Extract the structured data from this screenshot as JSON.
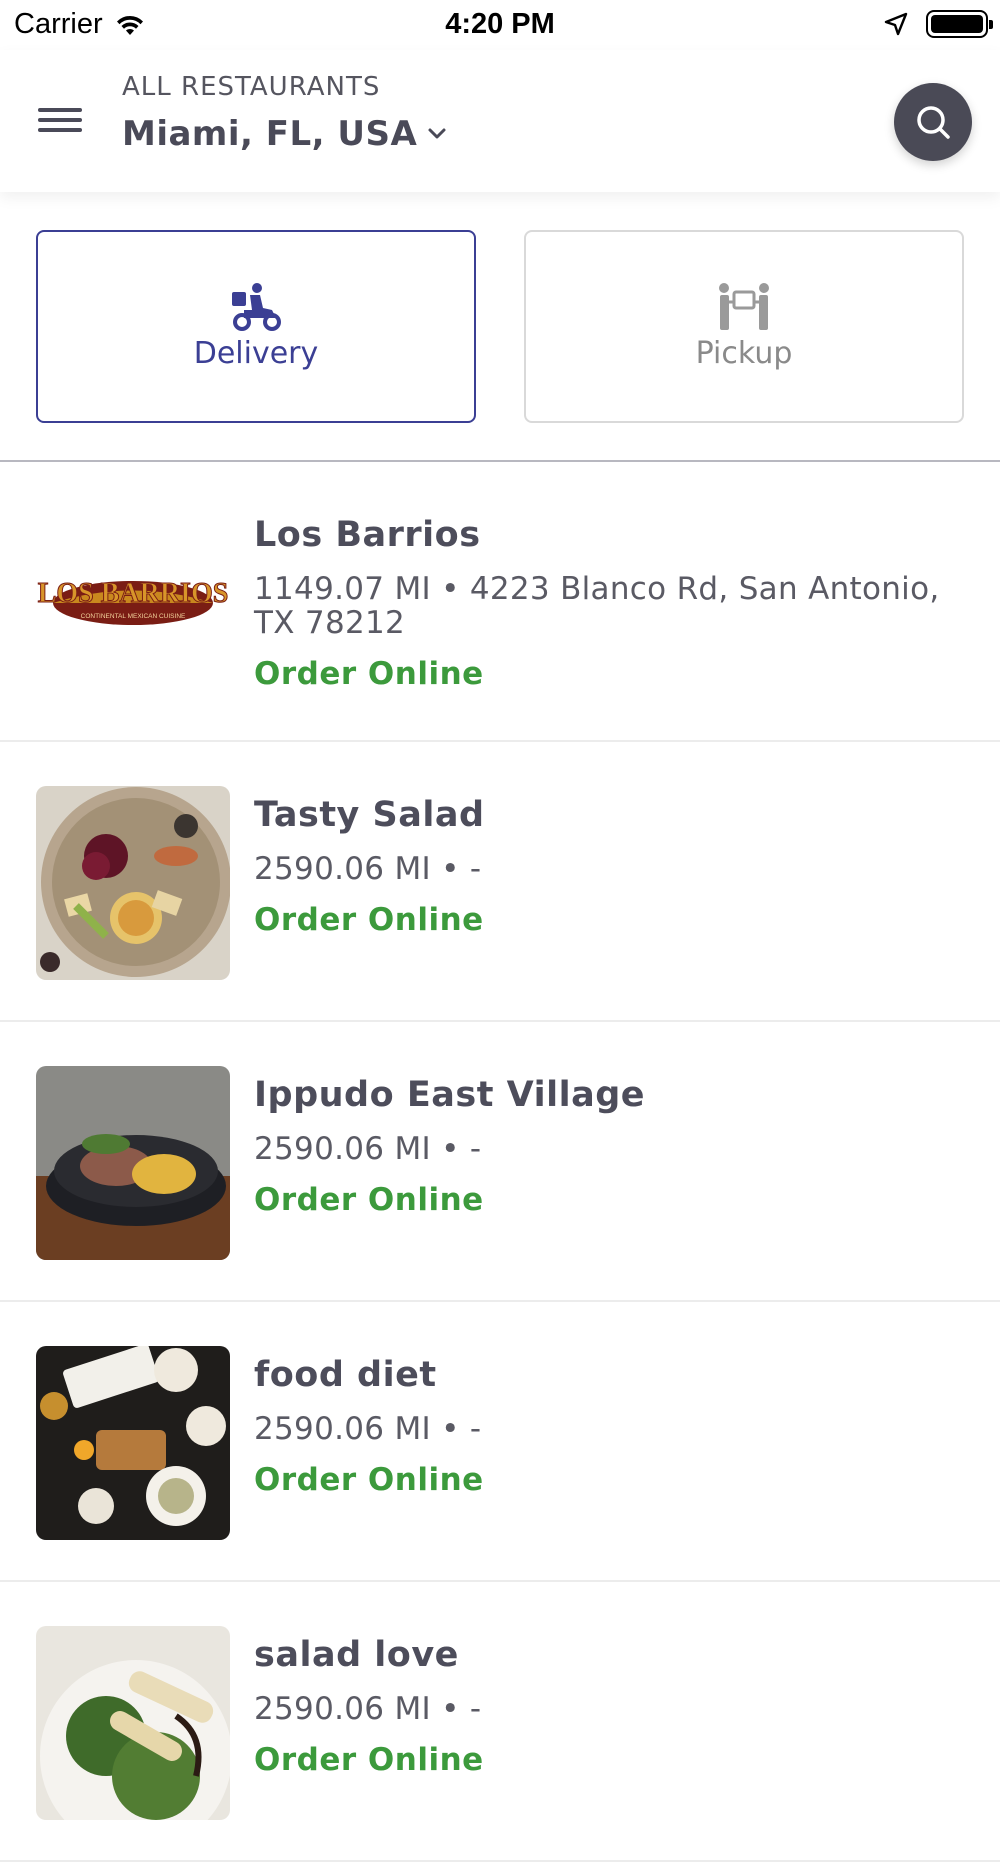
{
  "status_bar": {
    "carrier": "Carrier",
    "time": "4:20 PM"
  },
  "header": {
    "subtitle": "ALL RESTAURANTS",
    "location": "Miami, FL, USA"
  },
  "modes": {
    "delivery_label": "Delivery",
    "pickup_label": "Pickup",
    "selected": "Delivery",
    "accent_color": "#3b3f94"
  },
  "restaurants": [
    {
      "name": "Los Barrios",
      "address": "1149.07 MI • 4223 Blanco Rd, San Antonio, TX 78212",
      "action": "Order Online",
      "logo_text": "LOS BARRIOS",
      "logo_subtext": "CONTINENTAL MEXICAN CUISINE"
    },
    {
      "name": "Tasty Salad",
      "address": "2590.06 MI • -",
      "action": "Order Online"
    },
    {
      "name": "Ippudo East Village",
      "address": "2590.06 MI • -",
      "action": "Order Online"
    },
    {
      "name": "food diet",
      "address": "2590.06 MI • -",
      "action": "Order Online"
    },
    {
      "name": "salad love",
      "address": "2590.06 MI • -",
      "action": "Order Online"
    }
  ],
  "colors": {
    "order_online": "#3c9a3c",
    "text": "#4d4d5b"
  }
}
